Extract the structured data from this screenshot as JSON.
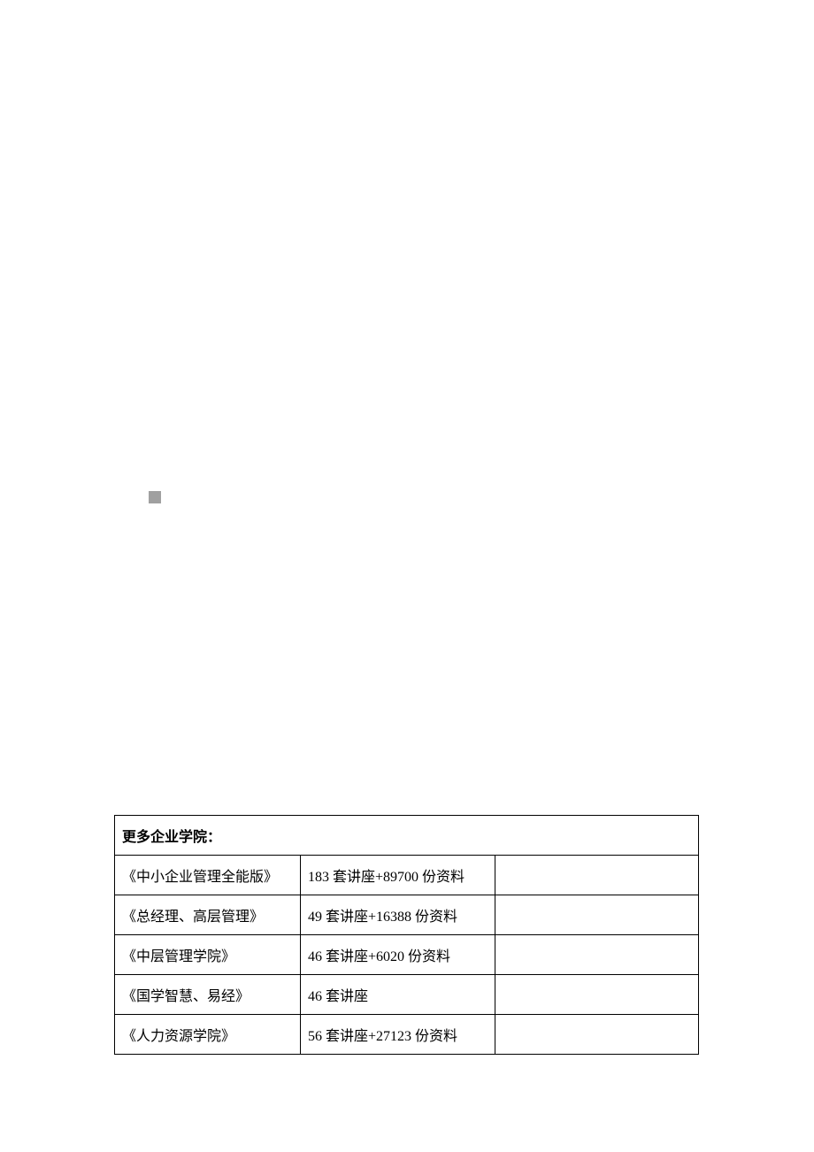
{
  "table": {
    "heading": "更多企业学院：",
    "rows": [
      {
        "name": "《中小企业管理全能版》",
        "desc": "183 套讲座+89700 份资料"
      },
      {
        "name": "《总经理、高层管理》",
        "desc": "49 套讲座+16388 份资料"
      },
      {
        "name": "《中层管理学院》",
        "desc": "46 套讲座+6020 份资料"
      },
      {
        "name": "《国学智慧、易经》",
        "desc": "46 套讲座"
      },
      {
        "name": "《人力资源学院》",
        "desc": "56 套讲座+27123 份资料"
      }
    ]
  }
}
